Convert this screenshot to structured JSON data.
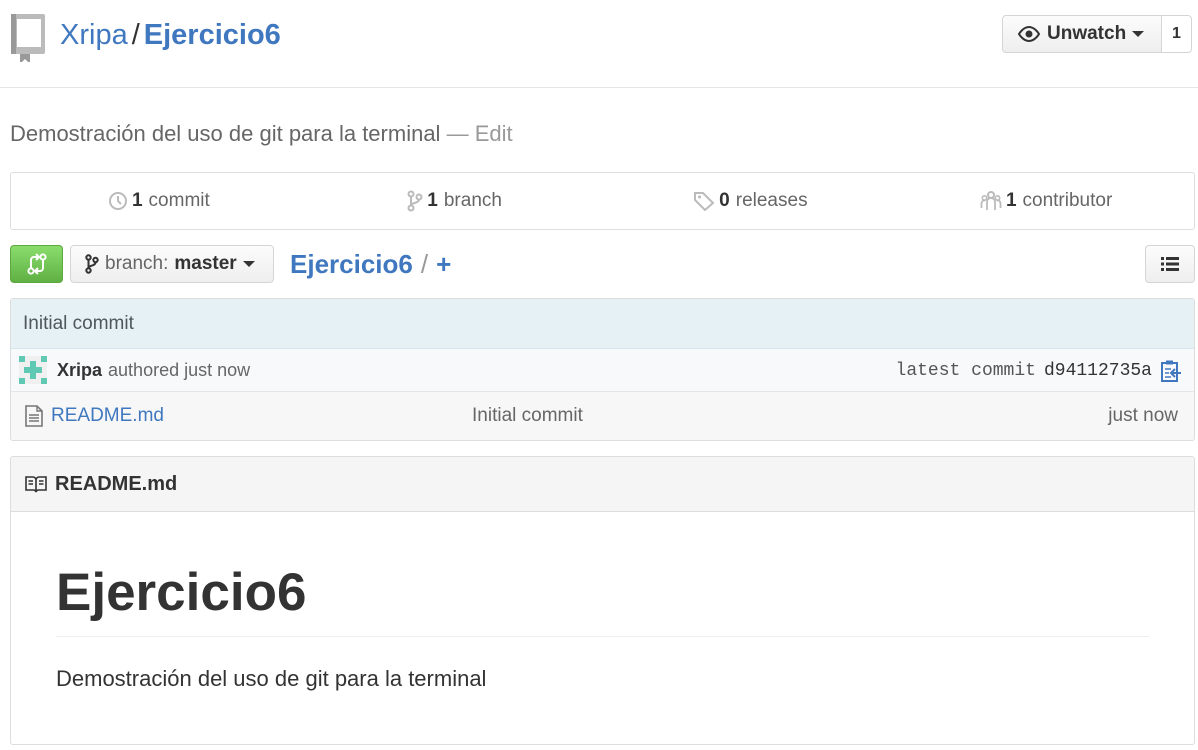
{
  "header": {
    "owner": "Xripa",
    "separator": "/",
    "repo": "Ejercicio6",
    "watch_label": "Unwatch",
    "watch_count": "1"
  },
  "description": {
    "text": "Demostración del uso de git para la terminal",
    "edit_label": "— Edit"
  },
  "summary": {
    "commits": {
      "count": "1",
      "label": "commit",
      "icon": "history-icon"
    },
    "branches": {
      "count": "1",
      "label": "branch",
      "icon": "git-branch-icon"
    },
    "releases": {
      "count": "0",
      "label": "releases",
      "icon": "tag-icon"
    },
    "contributors": {
      "count": "1",
      "label": "contributor",
      "icon": "organization-icon"
    }
  },
  "filenav": {
    "branch_prefix": "branch:",
    "branch_name": "master",
    "root": "Ejercicio6",
    "slash": "/",
    "plus": "+"
  },
  "commit": {
    "title": "Initial commit",
    "author": "Xripa",
    "authored": "authored just now",
    "latest_label": "latest commit",
    "sha": "d94112735a"
  },
  "files": [
    {
      "name": "README.md",
      "message": "Initial commit",
      "age": "just now"
    }
  ],
  "readme": {
    "header": "README.md",
    "h1": "Ejercicio6",
    "paragraph": "Demostración del uso de git para la terminal"
  },
  "colors": {
    "link": "#4078c0",
    "compare_green": "#60b044",
    "commit_bg": "#e6f1f6"
  }
}
